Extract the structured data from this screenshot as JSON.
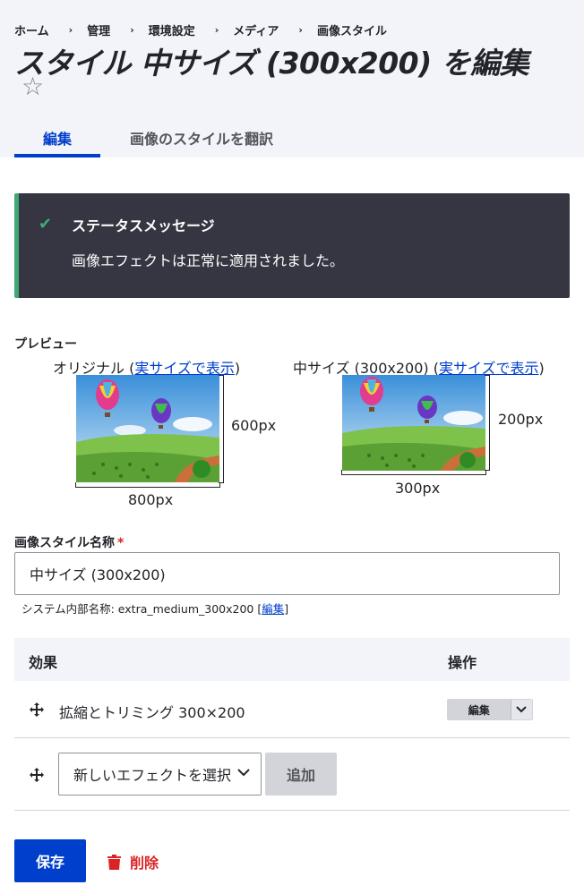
{
  "breadcrumb": [
    "ホーム",
    "管理",
    "環境設定",
    "メディア",
    "画像スタイル"
  ],
  "breadcrumb_separator": "›",
  "page_title": "スタイル 中サイズ (300x200) を編集",
  "star_icon": "☆",
  "tabs": [
    {
      "label": "編集",
      "active": true
    },
    {
      "label": "画像のスタイルを翻訳",
      "active": false
    }
  ],
  "status_message": {
    "title": "ステータスメッセージ",
    "text": "画像エフェクトは正常に適用されました。",
    "icon": "check-icon"
  },
  "preview": {
    "label": "プレビュー",
    "original": {
      "caption_prefix": "オリジナル (",
      "link": "実サイズで表示",
      "caption_suffix": ")",
      "width_label": "800px",
      "height_label": "600px"
    },
    "derivative": {
      "caption_prefix": "中サイズ (300x200) (",
      "link": "実サイズで表示",
      "caption_suffix": ")",
      "width_label": "300px",
      "height_label": "200px"
    }
  },
  "name_field": {
    "label": "画像スタイル名称",
    "required_mark": "*",
    "value": "中サイズ (300x200)",
    "machine_prefix": "システム内部名称: extra_medium_300x200 [",
    "machine_link": "編集",
    "machine_suffix": "]"
  },
  "effects_table": {
    "headers": [
      "効果",
      "操作"
    ],
    "rows": [
      {
        "name": "拡縮とトリミング 300×200",
        "operation": "編集"
      }
    ]
  },
  "new_effect": {
    "select_value": "新しいエフェクトを選択",
    "add_label": "追加"
  },
  "actions": {
    "save_label": "保存",
    "delete_label": "削除"
  },
  "colors": {
    "accent": "#003ecc",
    "success": "#42a877",
    "danger": "#dc2323",
    "message_bg": "#353641"
  }
}
